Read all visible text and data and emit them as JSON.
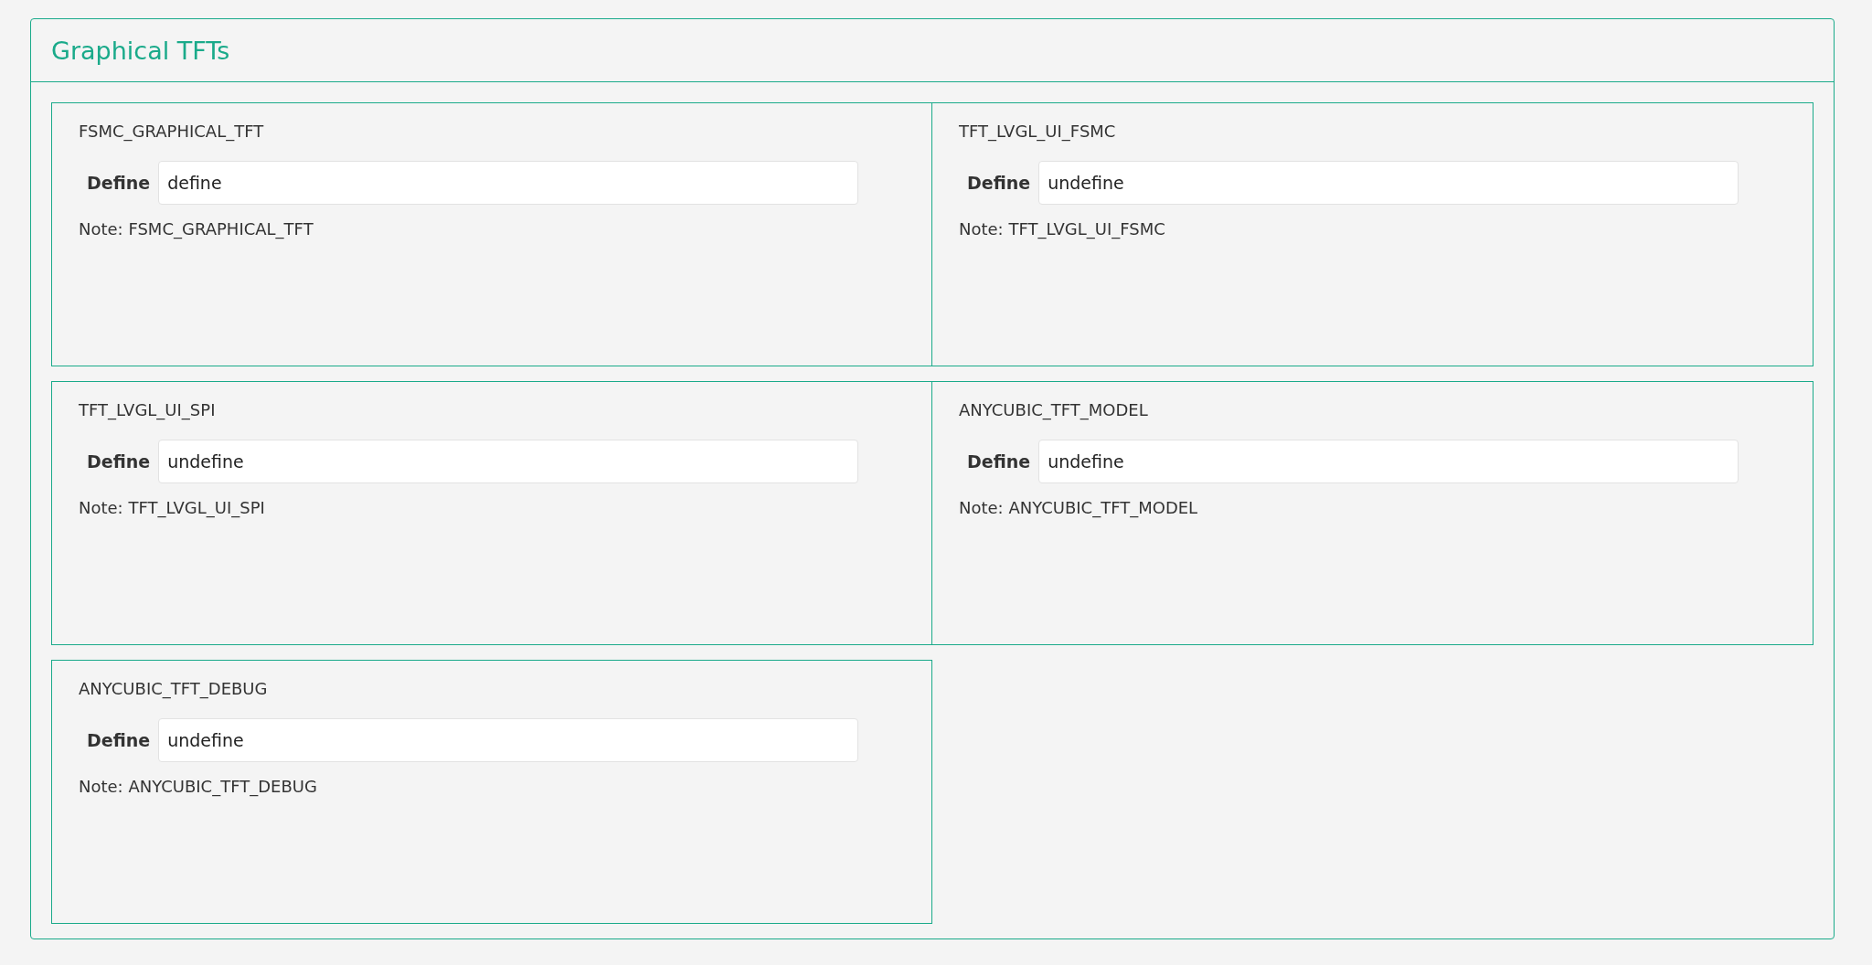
{
  "panel": {
    "title": "Graphical TFTs"
  },
  "options": [
    {
      "name": "FSMC_GRAPHICAL_TFT",
      "label": "Define",
      "value": "define",
      "note": "Note: FSMC_GRAPHICAL_TFT"
    },
    {
      "name": "TFT_LVGL_UI_FSMC",
      "label": "Define",
      "value": "undefine",
      "note": "Note: TFT_LVGL_UI_FSMC"
    },
    {
      "name": "TFT_LVGL_UI_SPI",
      "label": "Define",
      "value": "undefine",
      "note": "Note: TFT_LVGL_UI_SPI"
    },
    {
      "name": "ANYCUBIC_TFT_MODEL",
      "label": "Define",
      "value": "undefine",
      "note": "Note: ANYCUBIC_TFT_MODEL"
    },
    {
      "name": "ANYCUBIC_TFT_DEBUG",
      "label": "Define",
      "value": "undefine",
      "note": "Note: ANYCUBIC_TFT_DEBUG"
    }
  ]
}
